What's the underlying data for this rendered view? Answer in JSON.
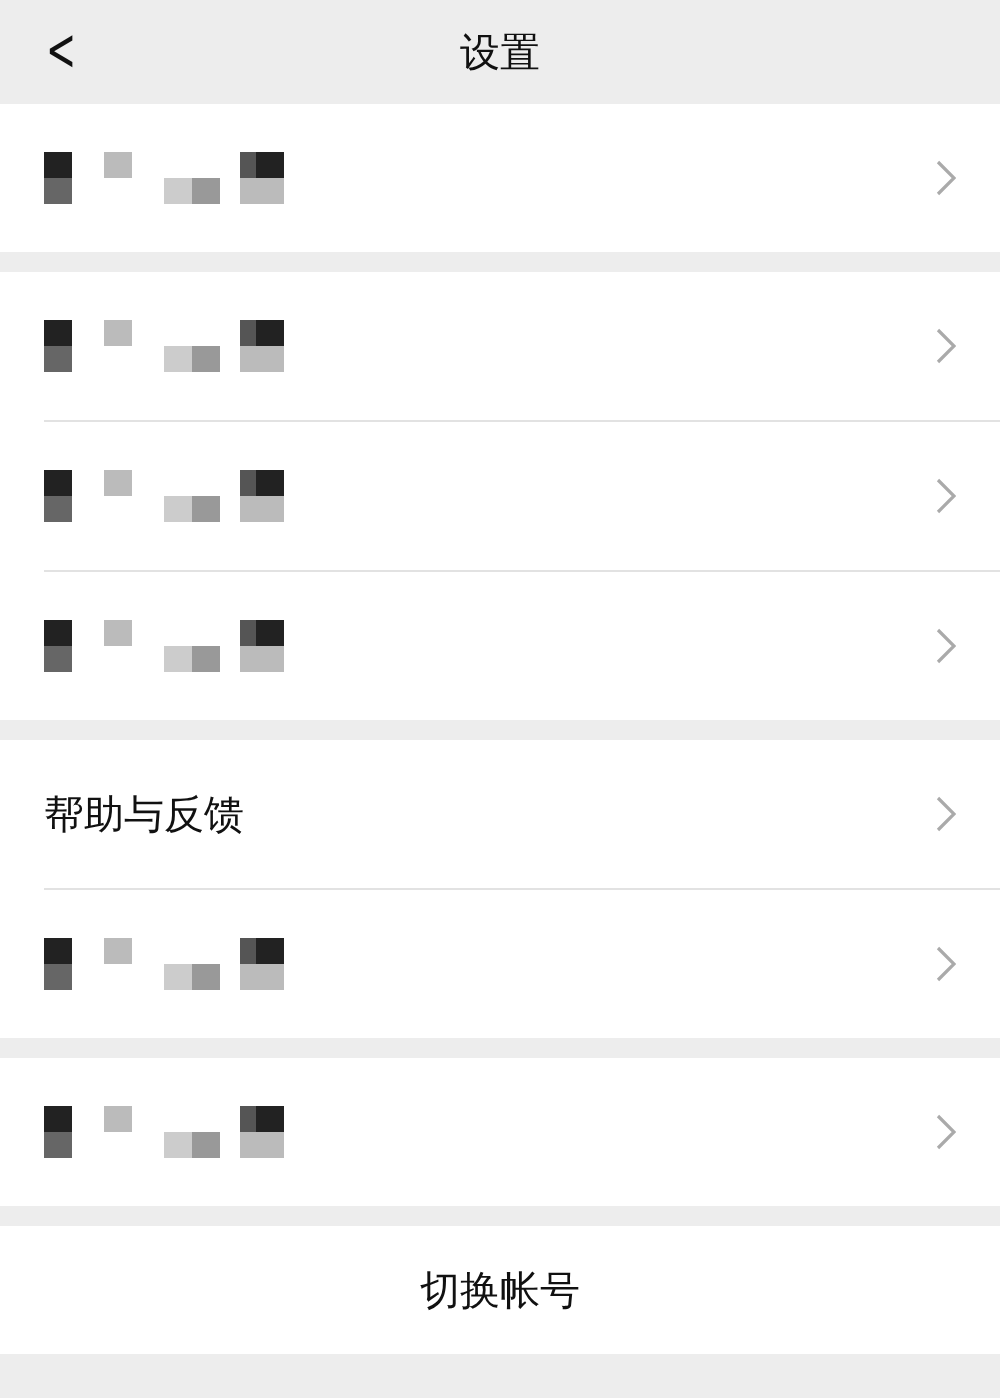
{
  "nav_bar": {
    "back": "<",
    "title": "设置"
  },
  "groups": [
    {
      "rows": [
        {
          "kind": "redacted"
        }
      ]
    },
    {
      "rows": [
        {
          "kind": "redacted"
        },
        {
          "kind": "redacted"
        },
        {
          "kind": "redacted"
        }
      ]
    },
    {
      "rows": [
        {
          "kind": "text",
          "label": "帮助与反馈"
        },
        {
          "kind": "redacted"
        }
      ]
    },
    {
      "rows": [
        {
          "kind": "redacted"
        }
      ]
    }
  ],
  "switch_account": "切换帐号"
}
